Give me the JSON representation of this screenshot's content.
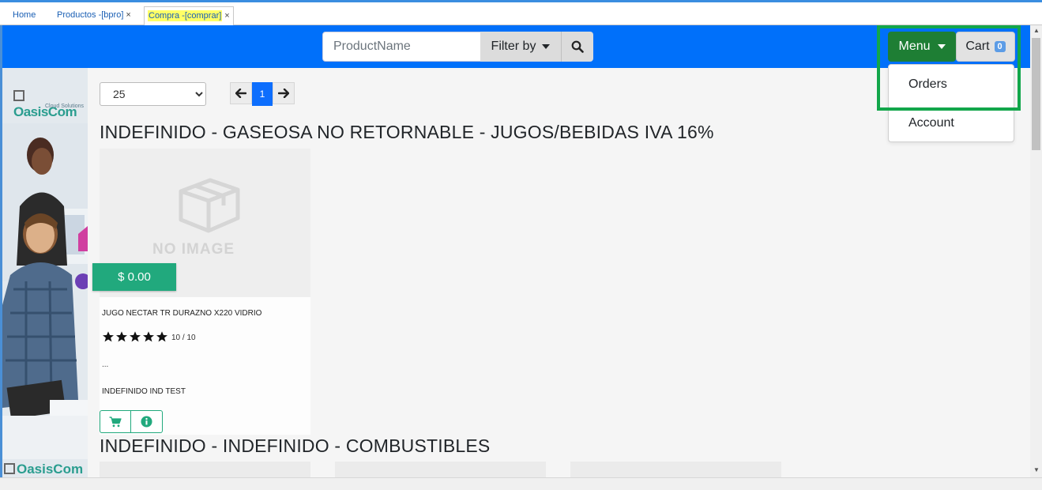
{
  "tabs": [
    {
      "label": "Home"
    },
    {
      "label": "Productos -[bpro]",
      "close": "×"
    },
    {
      "label": "Compra -[comprar]",
      "close": "×"
    }
  ],
  "navbar": {
    "search_placeholder": "ProductName",
    "filter_label": "Filter by",
    "menu_label": "Menu",
    "cart_label": "Cart",
    "cart_count": "0",
    "accent_color": "#0070fa"
  },
  "menu_dropdown": {
    "items": [
      {
        "label": "Orders"
      },
      {
        "label": "Account"
      }
    ]
  },
  "toolbar": {
    "page_size": "25",
    "current_page": "1"
  },
  "sections": [
    {
      "title": "INDEFINIDO - GASEOSA NO RETORNABLE - JUGOS/BEBIDAS IVA 16%"
    },
    {
      "title": "INDEFINIDO - INDEFINIDO - COMBUSTIBLES"
    }
  ],
  "product": {
    "image_text": "NO IMAGE",
    "price": "$ 0.00",
    "name": "JUGO NECTAR TR DURAZNO X220 VIDRIO",
    "stars": 5,
    "rating": "10 / 10",
    "description": "...",
    "brand": "INDEFINIDO IND TEST",
    "price_color": "#21a97d"
  },
  "ad": {
    "logo": "OasisCom",
    "logo_sub": "Cloud Solutions"
  }
}
